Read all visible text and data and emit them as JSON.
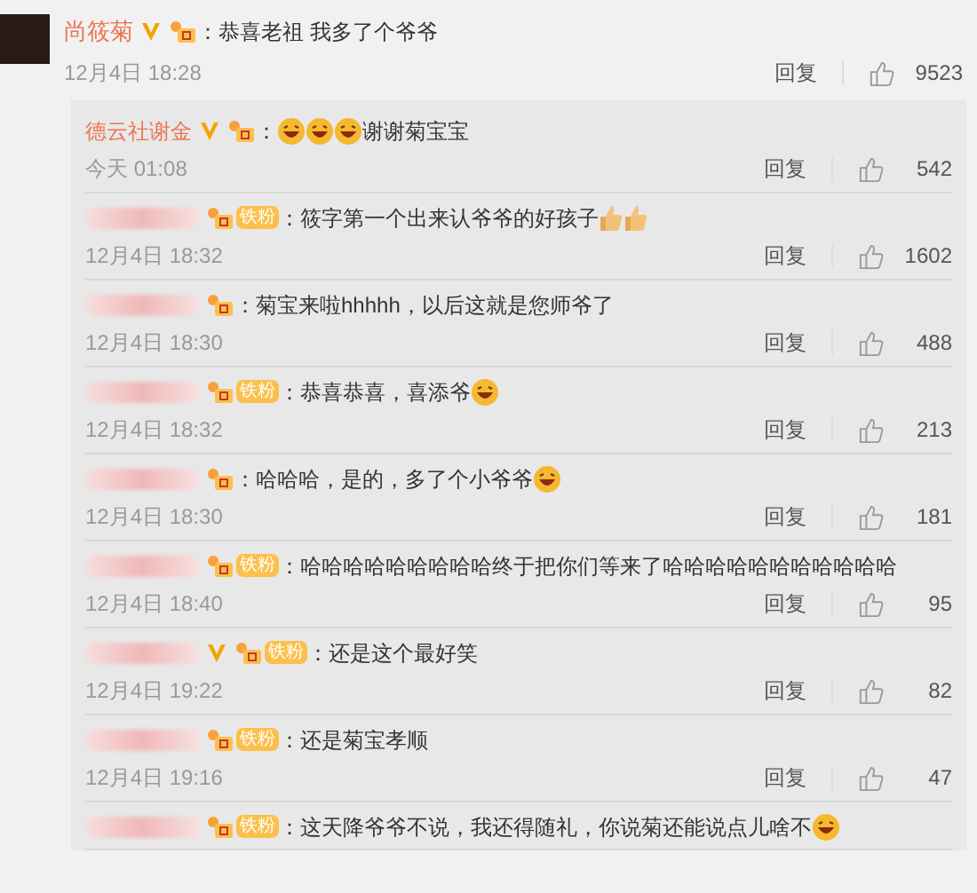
{
  "comment": {
    "user": "尚筱菊",
    "verified": true,
    "parts": [
      {
        "kind": "text",
        "text": "：恭喜老祖 我多了个爷爷"
      }
    ],
    "time": "12月4日 18:28",
    "reply_label": "回复",
    "likes": "9523"
  },
  "replies": [
    {
      "user": "德云社谢金",
      "verified": true,
      "parts": [
        {
          "kind": "text",
          "text": "："
        },
        {
          "kind": "emoji"
        },
        {
          "kind": "emoji"
        },
        {
          "kind": "emoji"
        },
        {
          "kind": "text",
          "text": "谢谢菊宝宝"
        }
      ],
      "time": "今天 01:08",
      "reply_label": "回复",
      "likes": "542"
    },
    {
      "verified": false,
      "fan_label": "铁粉",
      "parts": [
        {
          "kind": "text",
          "text": "：筱字第一个出来认爷爷的好孩子"
        },
        {
          "kind": "thumb"
        },
        {
          "kind": "thumb"
        }
      ],
      "time": "12月4日 18:32",
      "reply_label": "回复",
      "likes": "1602"
    },
    {
      "verified": false,
      "parts": [
        {
          "kind": "text",
          "text": "：菊宝来啦hhhhh，以后这就是您师爷了"
        }
      ],
      "time": "12月4日 18:30",
      "reply_label": "回复",
      "likes": "488"
    },
    {
      "verified": false,
      "fan_label": "铁粉",
      "parts": [
        {
          "kind": "text",
          "text": "：恭喜恭喜，喜添爷"
        },
        {
          "kind": "emoji"
        }
      ],
      "time": "12月4日 18:32",
      "reply_label": "回复",
      "likes": "213"
    },
    {
      "verified": false,
      "parts": [
        {
          "kind": "text",
          "text": "：哈哈哈，是的，多了个小爷爷"
        },
        {
          "kind": "emoji"
        }
      ],
      "time": "12月4日 18:30",
      "reply_label": "回复",
      "likes": "181"
    },
    {
      "verified": false,
      "fan_label": "铁粉",
      "parts": [
        {
          "kind": "text",
          "text": "：哈哈哈哈哈哈哈哈哈终于把你们等来了哈哈哈哈哈哈哈哈哈哈哈"
        }
      ],
      "time": "12月4日 18:40",
      "reply_label": "回复",
      "likes": "95"
    },
    {
      "verified": true,
      "fan_label": "铁粉",
      "parts": [
        {
          "kind": "text",
          "text": "：还是这个最好笑"
        }
      ],
      "time": "12月4日 19:22",
      "reply_label": "回复",
      "likes": "82"
    },
    {
      "verified": false,
      "fan_label": "铁粉",
      "parts": [
        {
          "kind": "text",
          "text": "：还是菊宝孝顺"
        }
      ],
      "time": "12月4日 19:16",
      "reply_label": "回复",
      "likes": "47"
    },
    {
      "verified": false,
      "fan_label": "铁粉",
      "parts": [
        {
          "kind": "text",
          "text": "：这天降爷爷不说，我还得随礼，你说菊还能说点儿啥不"
        },
        {
          "kind": "emoji"
        }
      ]
    }
  ]
}
